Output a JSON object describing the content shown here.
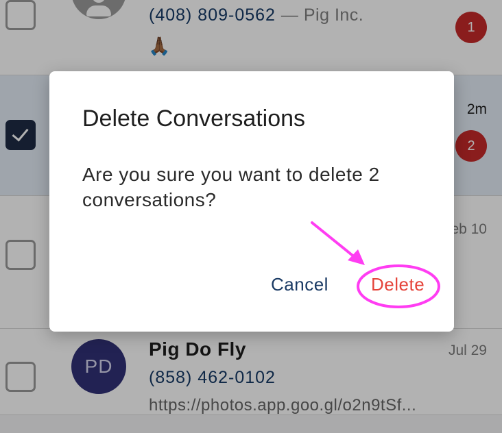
{
  "conversations": [
    {
      "phone": "(408) 809-0562",
      "company": "— Pig Inc.",
      "preview_emoji": "🙏🏾",
      "unread_count": "1",
      "selected": false
    },
    {
      "time": "2m",
      "unread_count": "2",
      "selected": true
    },
    {
      "time": "eb 10",
      "selected": false
    },
    {
      "name": "Pig Do Fly",
      "initials": "PD",
      "phone": "(858) 462-0102",
      "preview": "https://photos.app.goo.gl/o2n9tSf...",
      "time": "Jul 29",
      "selected": false
    }
  ],
  "dialog": {
    "title": "Delete Conversations",
    "message": "Are you sure you want to delete 2 conversations?",
    "cancel_label": "Cancel",
    "delete_label": "Delete"
  },
  "colors": {
    "accent_navy": "#163a66",
    "delete_red": "#e5443a",
    "badge_red": "#c62a2a",
    "annotation_magenta": "#ff3df2"
  },
  "icons": {
    "default_avatar": "person-icon",
    "checkbox_checked": "check-icon"
  }
}
